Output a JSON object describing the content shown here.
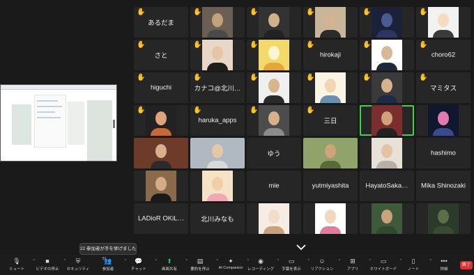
{
  "participants": [
    {
      "name": "あるだま",
      "hand": true,
      "video": false
    },
    {
      "name": "",
      "hand": true,
      "video": true,
      "bg": "#6b5e52",
      "skin": "#c2a27c",
      "shirt": "#4a4a4a"
    },
    {
      "name": "",
      "hand": true,
      "video": true,
      "bg": "#333333",
      "skin": "#d1b08c",
      "shirt": "#222222"
    },
    {
      "name": "",
      "hand": true,
      "video": true,
      "bg": "#c9b59a",
      "skin": "#d5b390",
      "shirt": "#2b2b2b"
    },
    {
      "name": "",
      "hand": true,
      "video": true,
      "bg": "#1b2138",
      "skin": "#4c5a92",
      "shirt": "#2c3560"
    },
    {
      "name": "",
      "hand": true,
      "video": true,
      "bg": "#f2f2f2",
      "skin": "#f4dcc2",
      "shirt": "#3a3a3a"
    },
    {
      "name": "さと",
      "hand": true,
      "video": false
    },
    {
      "name": "",
      "hand": true,
      "video": true,
      "bg": "#e8d6c7",
      "skin": "#e6c4a6",
      "shirt": "#1f1f1f"
    },
    {
      "name": "",
      "hand": true,
      "video": true,
      "bg": "#f3d96a",
      "skin": "#fff4d0",
      "shirt": "#e5a63a"
    },
    {
      "name": "hirokaji",
      "hand": true,
      "video": false
    },
    {
      "name": "",
      "hand": true,
      "video": true,
      "bg": "#ffffff",
      "skin": "#d9b89a",
      "shirt": "#1e2a3a"
    },
    {
      "name": "choro62",
      "hand": true,
      "video": false
    },
    {
      "name": "higuchi",
      "hand": true,
      "video": false
    },
    {
      "name": "カナコ@北川…",
      "hand": true,
      "video": false
    },
    {
      "name": "",
      "hand": true,
      "video": true,
      "bg": "#efefef",
      "skin": "#d8b48f",
      "shirt": "#2a2a2a"
    },
    {
      "name": "",
      "hand": true,
      "video": true,
      "bg": "#fbf3e3",
      "skin": "#f2d6b2",
      "shirt": "#6b8fb0"
    },
    {
      "name": "",
      "hand": true,
      "video": true,
      "bg": "#3a3a3a",
      "skin": "#d6b38e",
      "shirt": "#1f2a44"
    },
    {
      "name": "マミタス",
      "hand": true,
      "video": false
    },
    {
      "name": "",
      "hand": true,
      "video": true,
      "bg": "#222222",
      "skin": "#e0a27c",
      "shirt": "#c46a3a"
    },
    {
      "name": "haruka_apps",
      "hand": true,
      "video": false
    },
    {
      "name": "",
      "hand": true,
      "video": true,
      "bg": "#4c4c4c",
      "skin": "#d7b18b",
      "shirt": "#8c8c8c"
    },
    {
      "name": "三日",
      "hand": true,
      "video": false
    },
    {
      "name": "",
      "hand": false,
      "video": true,
      "active": true,
      "bg": "#7a2e2e",
      "skin": "#cfa27a",
      "shirt": "#222222"
    },
    {
      "name": "",
      "hand": false,
      "video": true,
      "bg": "#101830",
      "skin": "#e07ab0",
      "shirt": "#3a4b8a"
    },
    {
      "name": "",
      "hand": false,
      "video": true,
      "wide": true,
      "bg": "#6e3b2a",
      "skin": "#d9b08a",
      "shirt": "#2b2b2b"
    },
    {
      "name": "",
      "hand": false,
      "video": true,
      "wide": true,
      "bg": "#b0b8c2",
      "skin": "#e4c7a7",
      "shirt": "#d9d9d9"
    },
    {
      "name": "ゆう",
      "hand": false,
      "video": false
    },
    {
      "name": "",
      "hand": false,
      "video": true,
      "wide": true,
      "bg": "#8fa36b",
      "skin": "#cfa37c",
      "shirt": "#5a6a3a"
    },
    {
      "name": "",
      "hand": false,
      "video": true,
      "bg": "#e7e1d8",
      "skin": "#e2c3a4",
      "shirt": "#b8b0a4"
    },
    {
      "name": "hashimo",
      "hand": false,
      "video": false
    },
    {
      "name": "",
      "hand": false,
      "video": true,
      "bg": "#8a6a4a",
      "skin": "#d3ad88",
      "shirt": "#1a1a1a"
    },
    {
      "name": "",
      "hand": false,
      "video": true,
      "bg": "#f6e3c7",
      "skin": "#f0cfa8",
      "shirt": "#f2a7b4"
    },
    {
      "name": "mie",
      "hand": false,
      "video": false
    },
    {
      "name": "yutmiyashita",
      "hand": false,
      "video": false
    },
    {
      "name": "HayatoSaka…",
      "hand": false,
      "video": false
    },
    {
      "name": "Mika Shinozaki",
      "hand": false,
      "video": false
    },
    {
      "name": "LADioR OKiL…",
      "hand": false,
      "video": false
    },
    {
      "name": "北川みなも",
      "hand": false,
      "video": false
    },
    {
      "name": "",
      "hand": false,
      "video": true,
      "bg": "#f6ece4",
      "skin": "#f3dcc8",
      "shirt": "#c9a27a"
    },
    {
      "name": "",
      "hand": false,
      "video": true,
      "bg": "#ffffff",
      "skin": "#f1d7bd",
      "shirt": "#e27b9c"
    },
    {
      "name": "",
      "hand": false,
      "video": true,
      "bg": "#3e5a3a",
      "skin": "#caa27c",
      "shirt": "#2f4a2f"
    },
    {
      "name": "",
      "hand": false,
      "video": true,
      "bg": "#2b3a2a",
      "skin": "#5a6f4a",
      "shirt": "#3a4a32"
    }
  ],
  "notice": "22 参加者が手を挙げました",
  "toolbar": [
    {
      "label": "ミュート",
      "icon": "microphone-icon",
      "caret": true
    },
    {
      "label": "ビデオの停止",
      "icon": "video-camera-icon",
      "caret": true
    },
    {
      "label": "セキュリティ",
      "icon": "shield-icon",
      "caret": false
    },
    {
      "label": "参加者",
      "icon": "participants-icon",
      "caret": true,
      "count": "51"
    },
    {
      "label": "チャット",
      "icon": "chat-icon",
      "caret": true
    },
    {
      "label": "画面共有",
      "icon": "share-screen-icon",
      "caret": true,
      "green": true
    },
    {
      "label": "要約を停止",
      "icon": "summary-icon",
      "caret": true
    },
    {
      "label": "AI Companion",
      "icon": "ai-companion-icon",
      "caret": true
    },
    {
      "label": "レコーディング",
      "icon": "record-icon",
      "caret": true
    },
    {
      "label": "字幕を表示",
      "icon": "captions-icon",
      "caret": true
    },
    {
      "label": "リアクション",
      "icon": "reaction-icon",
      "caret": true
    },
    {
      "label": "アプリ",
      "icon": "apps-icon",
      "caret": true
    },
    {
      "label": "ホワイトボード",
      "icon": "whiteboard-icon",
      "caret": true
    },
    {
      "label": "ノート",
      "icon": "notes-icon",
      "caret": true
    },
    {
      "label": "詳細",
      "icon": "more-icon",
      "caret": false
    }
  ],
  "end_label": "終了"
}
